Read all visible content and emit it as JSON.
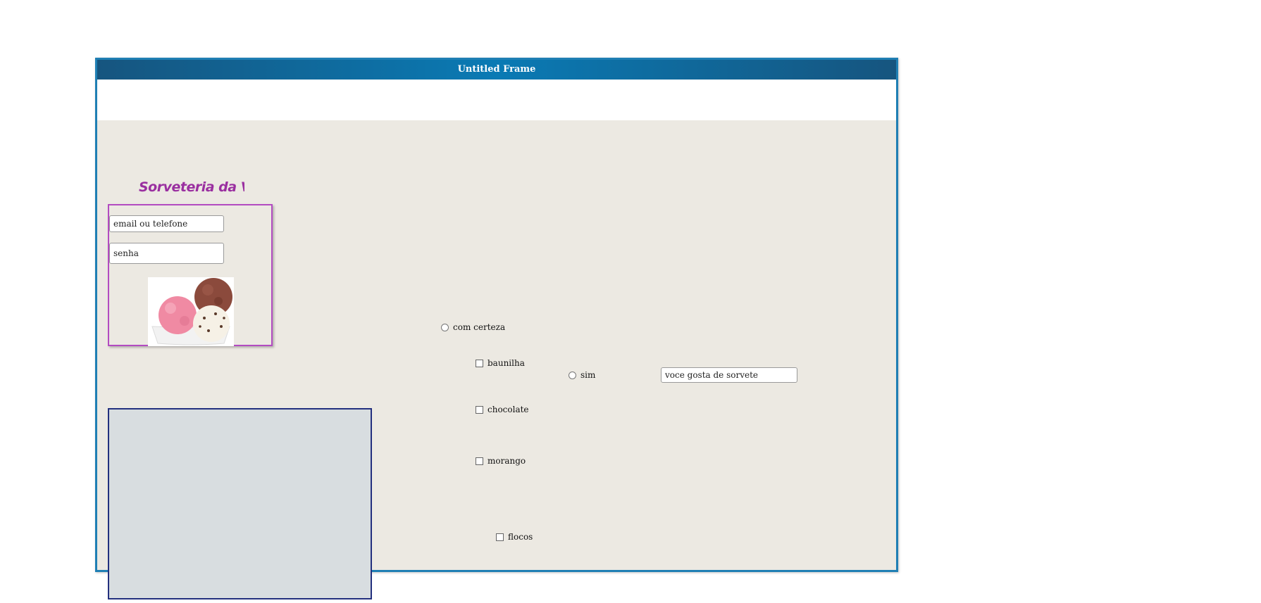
{
  "window": {
    "title": "Untitled Frame"
  },
  "brand": {
    "name": "Sorveteria da Vivi"
  },
  "login": {
    "email_placeholder": "email ou telefone",
    "password_placeholder": "senha",
    "image_icon": "ice-cream-scoops-image"
  },
  "options": {
    "radio_com_certeza": "com certeza",
    "radio_sim": "sim",
    "flavors": [
      {
        "label": "baunilha"
      },
      {
        "label": "chocolate"
      },
      {
        "label": "morango"
      },
      {
        "label": "flocos"
      }
    ]
  },
  "question": {
    "value": "voce gosta de sorvete"
  },
  "colors": {
    "titlebar": "#0a7ab4",
    "brand": "#9a2fa0",
    "login_border": "#b34bc1",
    "panel_fill": "#d8dde0",
    "panel_border": "#23307e",
    "canvas": "#ece9e2"
  }
}
